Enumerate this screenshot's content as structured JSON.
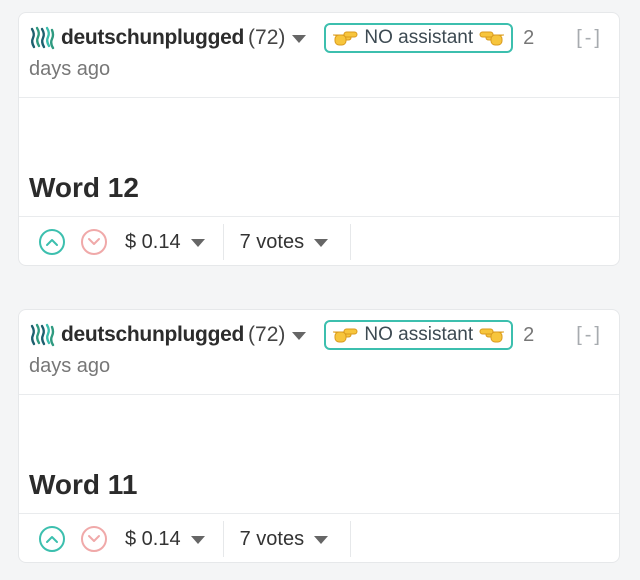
{
  "colors": {
    "accent": "#3cbfae",
    "downvote": "#f0a9a9",
    "text": "#2c2c2c",
    "muted": "#777777"
  },
  "posts": [
    {
      "author": "deutschunplugged",
      "reputation": "(72)",
      "badge": {
        "left_icon": "pointing-right-hand-icon",
        "text": "NO assistant",
        "right_icon": "pointing-left-hand-icon"
      },
      "age_number": "2",
      "age_unit": "days ago",
      "collapse_label": "[-]",
      "title": "Word 12",
      "payout": "$ 0.14",
      "votes": "7 votes"
    },
    {
      "author": "deutschunplugged",
      "reputation": "(72)",
      "badge": {
        "left_icon": "pointing-right-hand-icon",
        "text": "NO assistant",
        "right_icon": "pointing-left-hand-icon"
      },
      "age_number": "2",
      "age_unit": "days ago",
      "collapse_label": "[-]",
      "title": "Word 11",
      "payout": "$ 0.14",
      "votes": "7 votes"
    }
  ]
}
